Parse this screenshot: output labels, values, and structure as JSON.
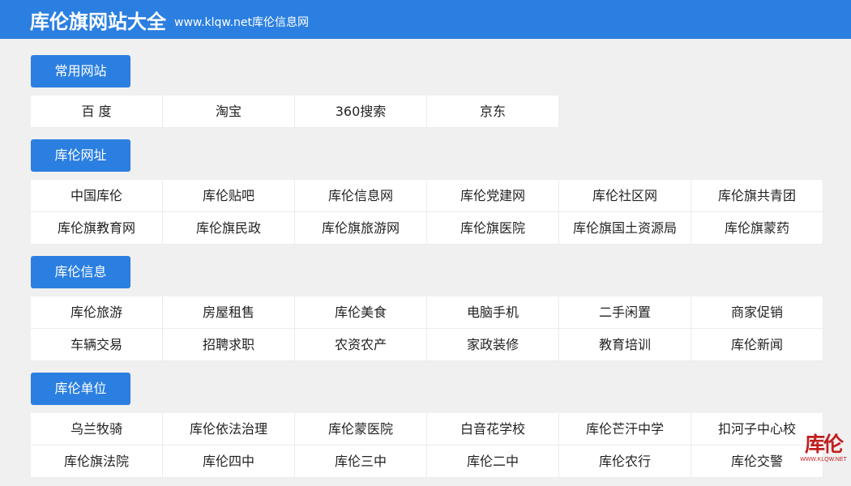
{
  "header": {
    "title": "库伦旗网站大全",
    "subtitle": "www.klqw.net库伦信息网"
  },
  "sections": [
    {
      "label": "常用网站",
      "items": [
        "百 度",
        "淘宝",
        "360搜索",
        "京东"
      ]
    },
    {
      "label": "库伦网址",
      "items": [
        "中国库伦",
        "库伦贴吧",
        "库伦信息网",
        "库伦党建网",
        "库伦社区网",
        "库伦旗共青团",
        "库伦旗教育网",
        "库伦旗民政",
        "库伦旗旅游网",
        "库伦旗医院",
        "库伦旗国土资源局",
        "库伦旗蒙药"
      ]
    },
    {
      "label": "库伦信息",
      "items": [
        "库伦旅游",
        "房屋租售",
        "库伦美食",
        "电脑手机",
        "二手闲置",
        "商家促销",
        "车辆交易",
        "招聘求职",
        "农资农产",
        "家政装修",
        "教育培训",
        "库伦新闻"
      ]
    },
    {
      "label": "库伦单位",
      "items": [
        "乌兰牧骑",
        "库伦依法治理",
        "库伦蒙医院",
        "白音花学校",
        "库伦芒汗中学",
        "扣河子中心校",
        "库伦旗法院",
        "库伦四中",
        "库伦三中",
        "库伦二中",
        "库伦农行",
        "库伦交警"
      ]
    }
  ],
  "logo": {
    "mark": "库伦",
    "url": "WWW.KLQW.NET"
  }
}
